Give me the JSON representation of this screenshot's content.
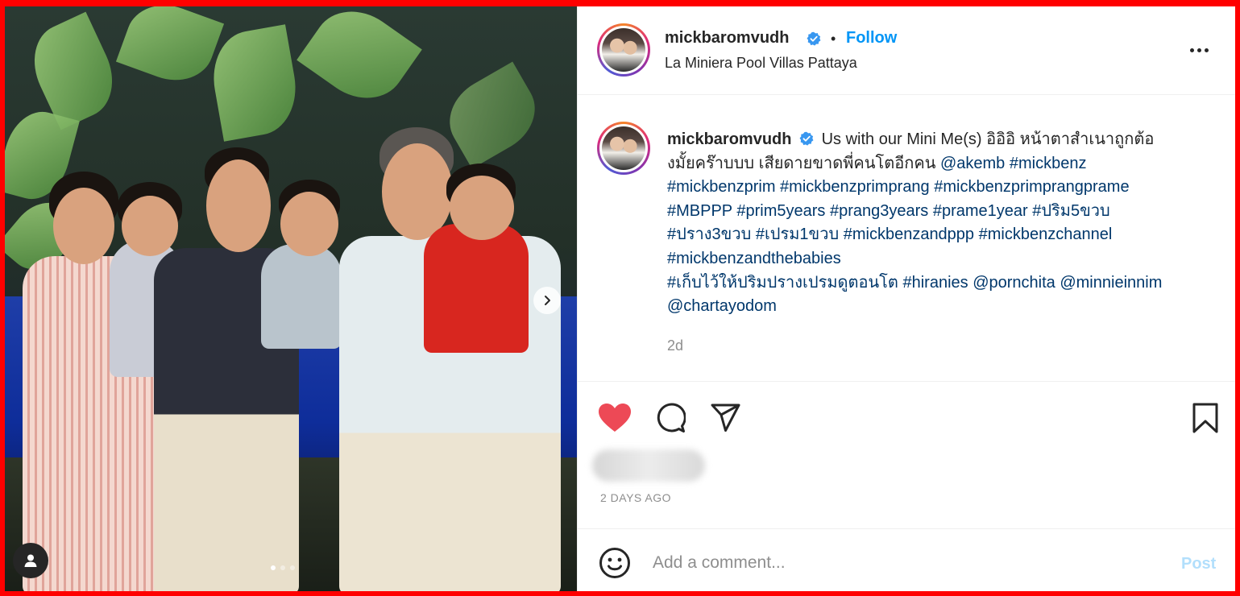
{
  "post": {
    "username": "mickbaromvudh",
    "follow_label": "Follow",
    "separator": "•",
    "location": "La Miniera Pool Villas Pattaya",
    "caption": {
      "username": "mickbaromvudh",
      "line1_text": "Us with our Mini Me(s) อิอิอิ หน้าตาสำเนาถูกต้อ",
      "line2_text": "งมั้ยคร๊าบบบ เสียดายขาดพี่คนโตอีกคน",
      "line2_mention": "@akemb",
      "line2_tag": "#mickbenz",
      "line3": [
        "#mickbenzprim",
        "#mickbenzprimprang",
        "#mickbenzprimprangprame"
      ],
      "line4": [
        "#MBPPP",
        "#prim5years",
        "#prang3years",
        "#prame1year",
        "#ปริม5ขวบ"
      ],
      "line5": [
        "#ปราง3ขวบ",
        "#เปรม1ขวบ",
        "#mickbenzandppp",
        "#mickbenzchannel"
      ],
      "line6": [
        "#mickbenzandthebabies"
      ],
      "line7": [
        "#เก็บไว้ให้ปริมปรางเปรมดูตอนโต",
        "#hiranies",
        "@pornchita",
        "@minnieinnim"
      ],
      "line8": [
        "@chartayodom"
      ]
    },
    "caption_age": "2d",
    "posted_ago": "2 DAYS AGO",
    "comment_placeholder": "Add a comment...",
    "post_label": "Post",
    "carousel": {
      "total": 3,
      "active": 1
    },
    "colors": {
      "like": "#ed4956",
      "link": "#00376b",
      "follow": "#0095f6",
      "post_disabled": "#b2dffc"
    },
    "icons": [
      "verified-badge-icon",
      "more-options-icon",
      "heart-icon",
      "comment-icon",
      "share-icon",
      "bookmark-icon",
      "emoji-icon",
      "user-tag-icon",
      "chevron-right-icon"
    ]
  }
}
